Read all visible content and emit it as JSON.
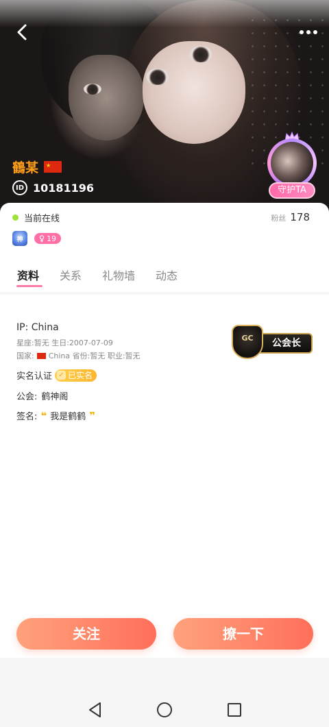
{
  "header": {
    "nickname": "鶴某",
    "id_label": "ID",
    "user_id": "10181196",
    "guard_label": "守护TA",
    "icons": [
      "back-arrow-icon",
      "more-dots-icon",
      "china-flag-icon",
      "id-icon"
    ]
  },
  "status": {
    "online_text": "当前在线",
    "fans_label": "粉丝",
    "fans_count": "178",
    "badge_text": "神",
    "age": "19",
    "age_gender_icon": "female-icon"
  },
  "tabs": [
    {
      "label": "资料",
      "active": true
    },
    {
      "label": "关系",
      "active": false
    },
    {
      "label": "礼物墙",
      "active": false
    },
    {
      "label": "动态",
      "active": false
    }
  ],
  "profile": {
    "ip": "IP: China",
    "constellation_birthday": "星座:暂无  生日:2007-07-09",
    "country_label": "国家:",
    "country_rest": "China  省份:暂无  职业:暂无",
    "realname_label": "实名认证",
    "realname_badge": "已实名",
    "guild_label": "公会:",
    "guild_name": "鹤神阁",
    "signature_label": "签名:",
    "signature_text": "我是鹤鹤",
    "guild_badge": {
      "shield_text": "GC",
      "plate_text": "公会长"
    }
  },
  "actions": {
    "follow": "关注",
    "poke": "撩一下"
  },
  "colors": {
    "accent_orange": "#ff7a5c",
    "tab_underline": "#ff7aa6",
    "online_dot": "#9be23a",
    "nickname": "#ff9f1a"
  }
}
